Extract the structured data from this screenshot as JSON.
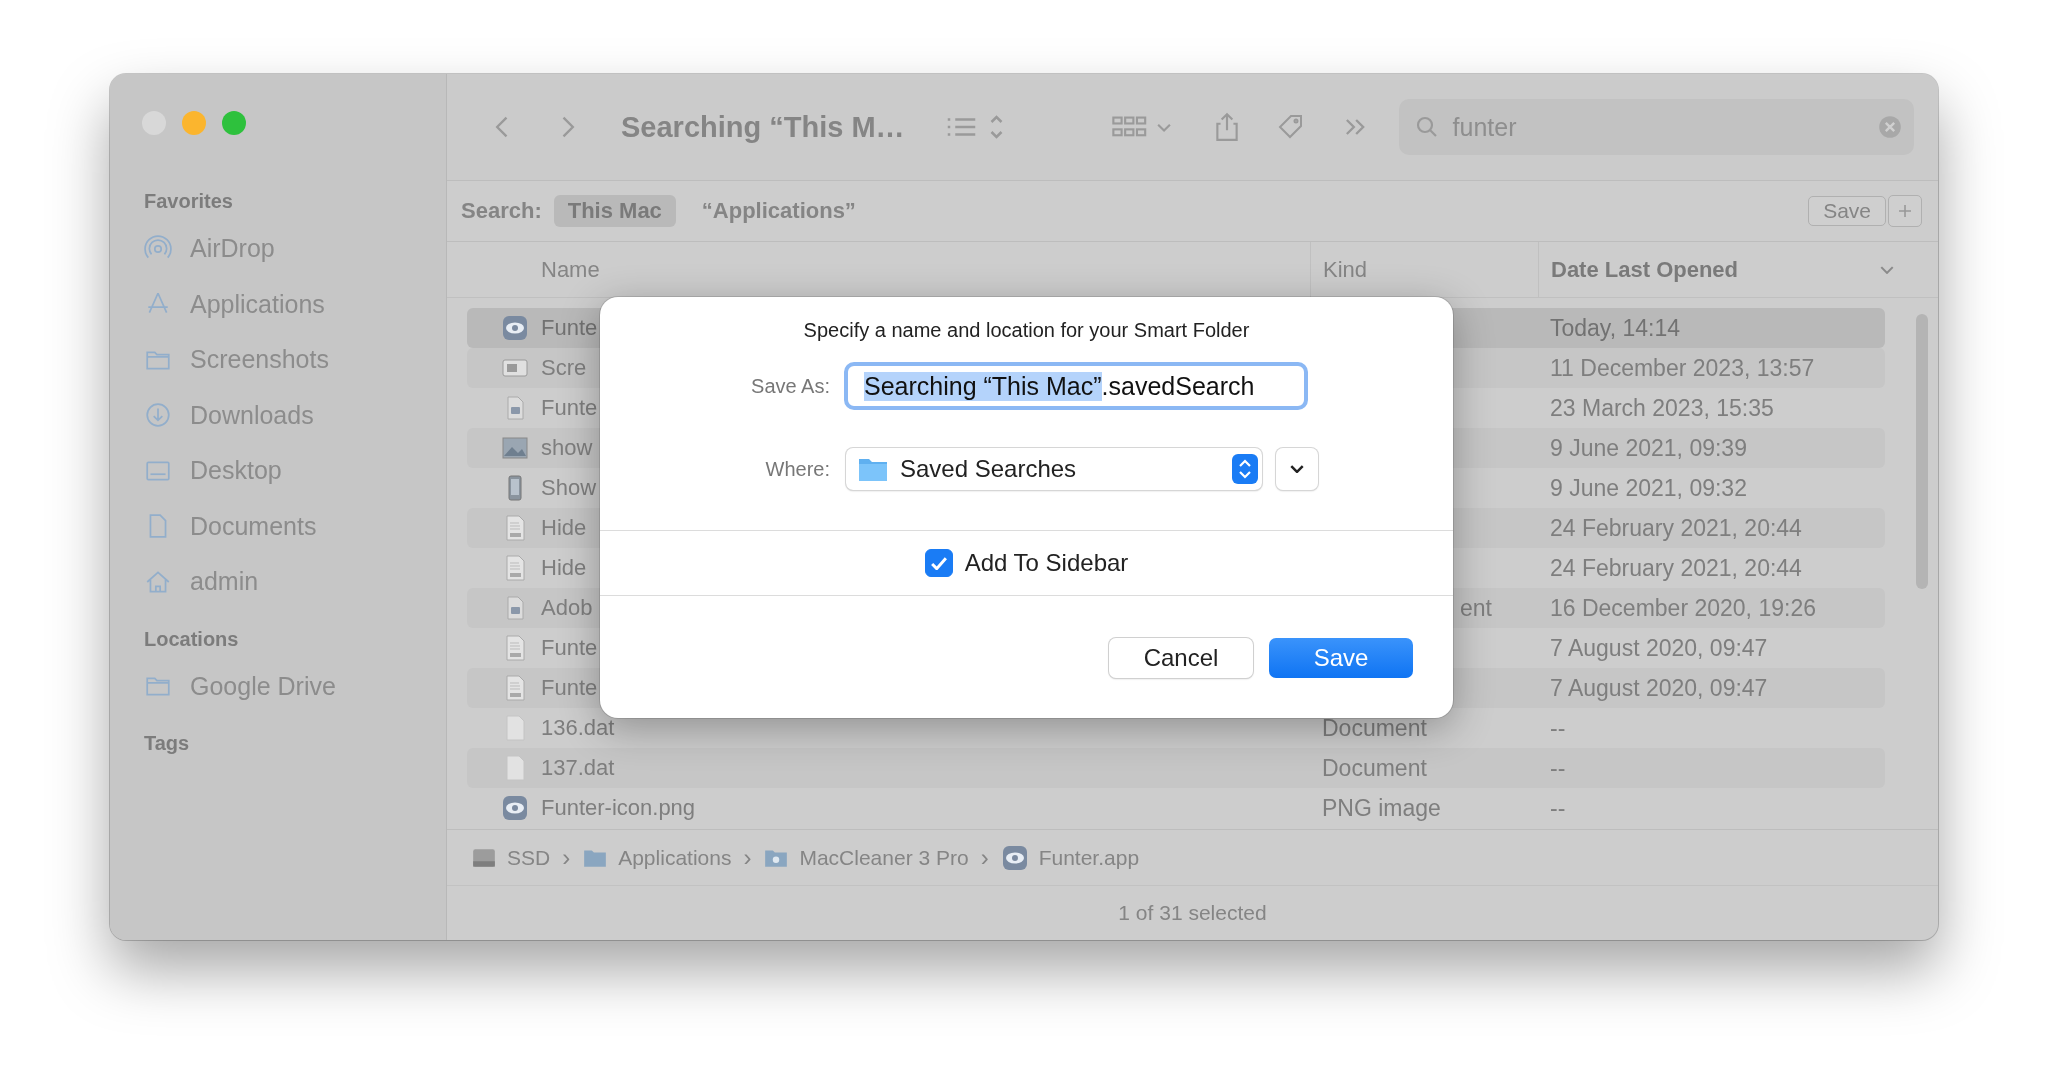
{
  "toolbar": {
    "title": "Searching “This M…",
    "search": {
      "value": "funter"
    }
  },
  "search_bar": {
    "label": "Search:",
    "scopes": [
      {
        "label": "This Mac",
        "selected": true
      },
      {
        "label": "“Applications”",
        "selected": false
      }
    ],
    "save_button": "Save"
  },
  "sidebar": {
    "sections": [
      {
        "title": "Favorites",
        "items": [
          {
            "label": "AirDrop",
            "kind": "airdrop"
          },
          {
            "label": "Applications",
            "kind": "apps"
          },
          {
            "label": "Screenshots",
            "kind": "folder"
          },
          {
            "label": "Downloads",
            "kind": "download"
          },
          {
            "label": "Desktop",
            "kind": "desktop"
          },
          {
            "label": "Documents",
            "kind": "doc"
          },
          {
            "label": "admin",
            "kind": "home"
          }
        ]
      },
      {
        "title": "Locations",
        "items": [
          {
            "label": "Google Drive",
            "kind": "folder"
          }
        ]
      },
      {
        "title": "Tags"
      }
    ]
  },
  "table": {
    "columns": [
      {
        "label": "Name",
        "sorted": false
      },
      {
        "label": "Kind",
        "sorted": false
      },
      {
        "label": "Date Last Opened",
        "sorted": true
      }
    ],
    "rows": [
      {
        "kind": "app",
        "name": "Funte",
        "date": "Today, 14:14",
        "selected": true
      },
      {
        "kind": "screenshot",
        "name": "Scre",
        "date": "11 December 2023, 13:57",
        "selected": false
      },
      {
        "kind": "package",
        "name": "Funte",
        "date": "23 March 2023, 15:35",
        "selected": false
      },
      {
        "kind": "image",
        "name": "show",
        "date": "9 June 2021, 09:39",
        "selected": false
      },
      {
        "kind": "phone",
        "name": "Show",
        "date": "9 June 2021, 09:32",
        "selected": false
      },
      {
        "kind": "txt",
        "name": "Hide",
        "date": "24 February 2021, 20:44",
        "selected": false
      },
      {
        "kind": "txt",
        "name": "Hide",
        "date": "24 February 2021, 20:44",
        "selected": false
      },
      {
        "kind": "package",
        "name": "Adob",
        "kind_text": "ent",
        "kind_partial": true,
        "date": "16 December 2020, 19:26",
        "selected": false
      },
      {
        "kind": "txt",
        "name": "Funte",
        "date": "7 August 2020, 09:47",
        "selected": false
      },
      {
        "kind": "txt",
        "name": "Funte",
        "date": "7 August 2020, 09:47",
        "selected": false
      },
      {
        "kind": "blank",
        "name": "136.dat",
        "kind_text": "Document",
        "kind_partial": false,
        "date": "--",
        "selected": false
      },
      {
        "kind": "blank",
        "name": "137.dat",
        "kind_text": "Document",
        "kind_partial": false,
        "date": "--",
        "selected": false
      },
      {
        "kind": "app",
        "name": "Funter-icon.png",
        "kind_text": "PNG image",
        "kind_partial": false,
        "date": "--",
        "selected": false
      }
    ]
  },
  "path_bar": [
    {
      "label": "SSD",
      "kind": "disk"
    },
    {
      "separator": "›",
      "label": "Applications",
      "kind": "folder"
    },
    {
      "separator": "›",
      "label": "MacCleaner 3 Pro",
      "kind": "appfolder"
    },
    {
      "separator": "›",
      "label": "Funter.app",
      "kind": "app"
    }
  ],
  "status_bar": "1 of 31 selected",
  "dialog": {
    "title": "Specify a name and location for your Smart Folder",
    "save_as": {
      "label": "Save As:",
      "value_parts": [
        {
          "text": "Searching “This Mac”",
          "selected": true
        },
        {
          "text": ".savedSearch",
          "selected": false
        }
      ]
    },
    "where": {
      "label": "Where:",
      "value": "Saved Searches"
    },
    "add_to_sidebar": {
      "label": "Add To Sidebar",
      "checked": true
    },
    "buttons": [
      {
        "label": "Cancel",
        "kind": "secondary"
      },
      {
        "label": "Save",
        "kind": "primary"
      }
    ]
  }
}
